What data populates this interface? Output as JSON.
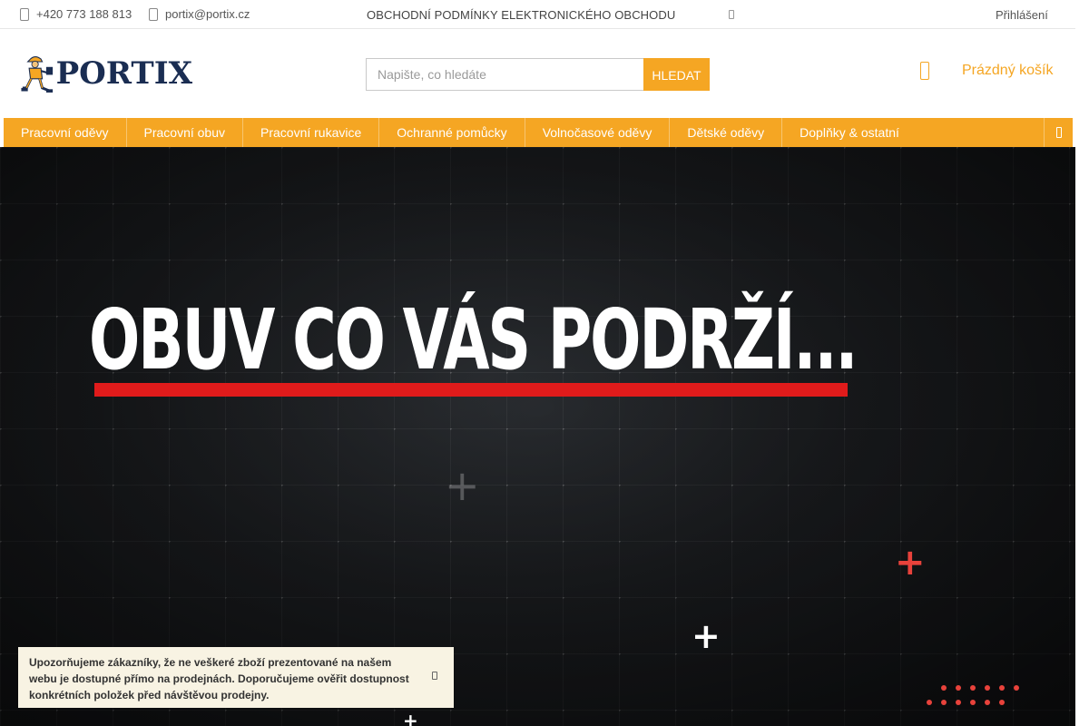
{
  "topbar": {
    "phone": "+420 773 188 813",
    "email": "portix@portix.cz",
    "terms_link": "OBCHODNÍ PODMÍNKY ELEKTRONICKÉHO OBCHODU",
    "login": "Přihlášení",
    "icons": {
      "phone": "phone-icon",
      "email": "envelope-icon",
      "more": "chevron-icon"
    }
  },
  "header": {
    "logo_text": "PORTIX",
    "search": {
      "placeholder": "Napište, co hledáte",
      "button_label": "HLEDAT"
    },
    "cart_label": "Prázdný košík",
    "cart_icon": "cart-icon"
  },
  "nav": {
    "items": [
      {
        "label": "Pracovní oděvy"
      },
      {
        "label": "Pracovní obuv"
      },
      {
        "label": "Pracovní rukavice"
      },
      {
        "label": "Ochranné pomůcky"
      },
      {
        "label": "Volnočasové oděvy"
      },
      {
        "label": "Dětské oděvy"
      },
      {
        "label": "Doplňky & ostatní"
      }
    ],
    "menu_icon": "menu-toggle-icon"
  },
  "hero": {
    "title": "OBUV CO VÁS PODRŽÍ..."
  },
  "notice": {
    "text": "Upozorňujeme zákazníky, že ne veškeré zboží prezentované na našem webu je dostupné přímo na prodejnách. Doporučujeme ověřit dostupnost konkrétních položek před návštěvou prodejny."
  },
  "colors": {
    "accent": "#f5a623",
    "logo_navy": "#1a2d52",
    "hero_bg": "#1c1e21",
    "hero_red": "#e01b1b",
    "notice_bg": "#f8f3e3"
  }
}
